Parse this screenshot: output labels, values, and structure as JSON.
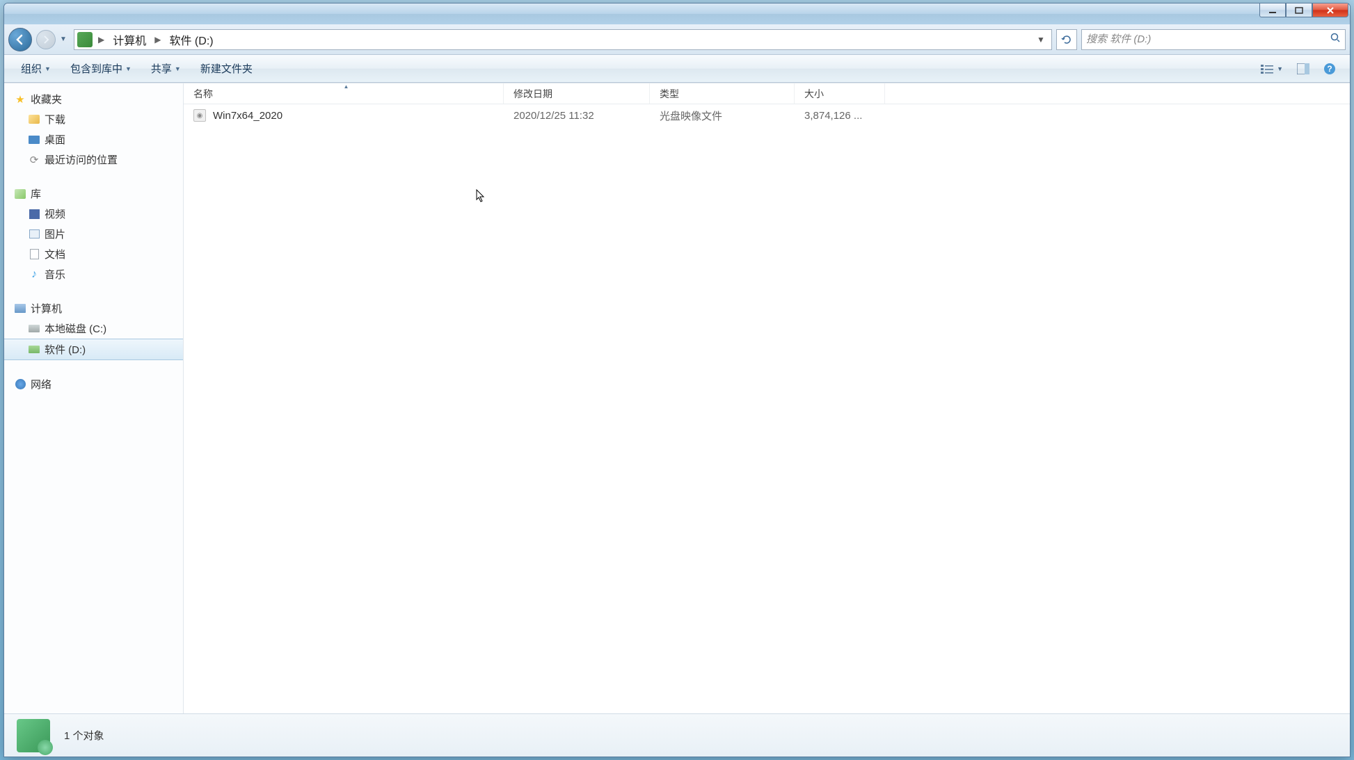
{
  "window": {
    "min_tip": "Minimize",
    "max_tip": "Maximize",
    "close_tip": "Close"
  },
  "breadcrumb": {
    "seg1": "计算机",
    "seg2": "软件 (D:)"
  },
  "search": {
    "placeholder": "搜索 软件 (D:)"
  },
  "toolbar": {
    "organize": "组织",
    "include": "包含到库中",
    "share": "共享",
    "new_folder": "新建文件夹"
  },
  "sidebar": {
    "favorites": "收藏夹",
    "downloads": "下载",
    "desktop": "桌面",
    "recent": "最近访问的位置",
    "libraries": "库",
    "video": "视频",
    "pictures": "图片",
    "documents": "文档",
    "music": "音乐",
    "computer": "计算机",
    "drive_c": "本地磁盘 (C:)",
    "drive_d": "软件 (D:)",
    "network": "网络"
  },
  "columns": {
    "name": "名称",
    "date": "修改日期",
    "type": "类型",
    "size": "大小"
  },
  "files": [
    {
      "name": "Win7x64_2020",
      "date": "2020/12/25 11:32",
      "type": "光盘映像文件",
      "size": "3,874,126 ..."
    }
  ],
  "status": {
    "count_label": "1 个对象"
  }
}
